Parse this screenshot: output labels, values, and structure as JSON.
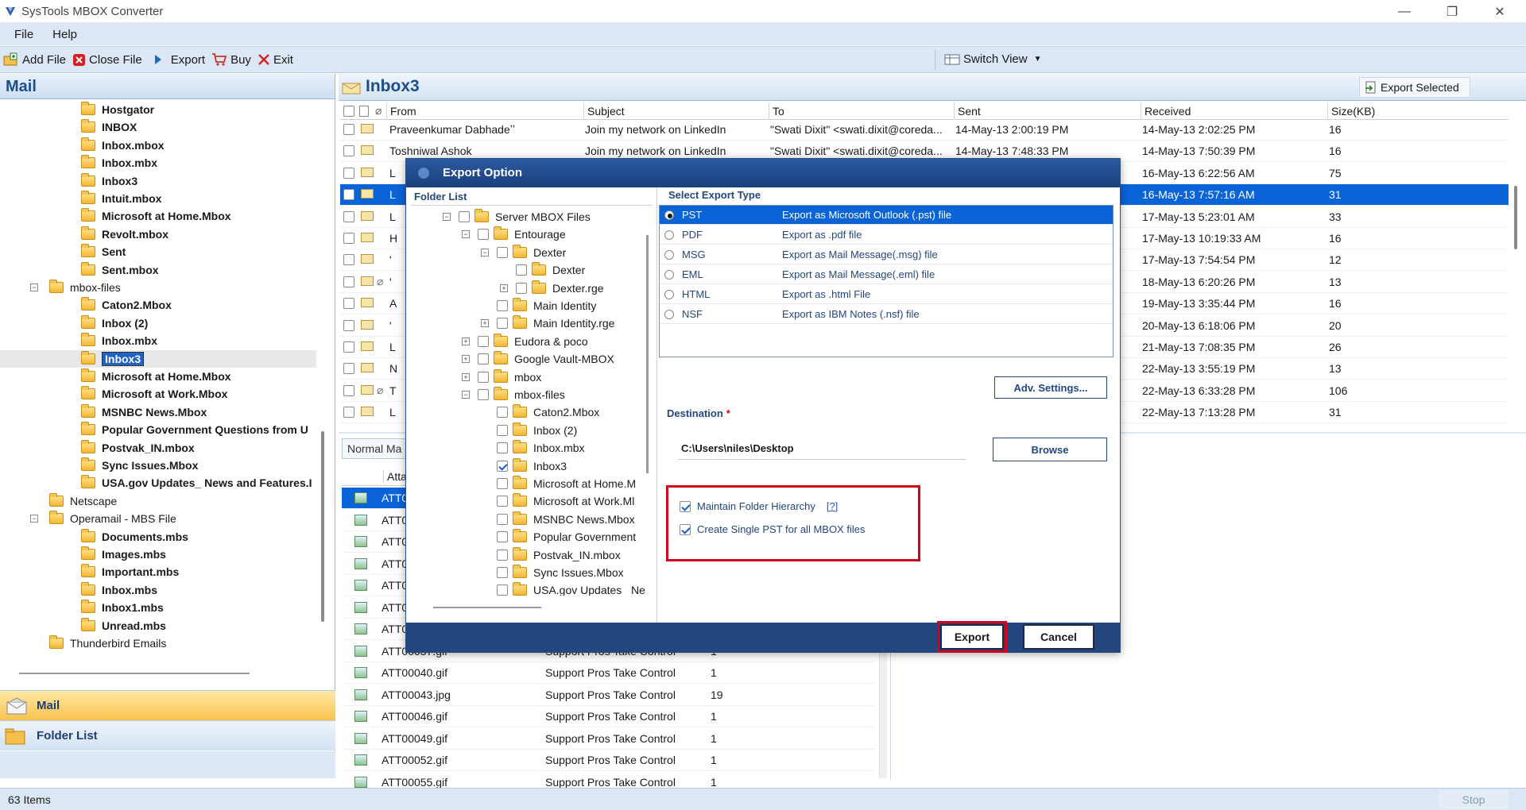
{
  "window": {
    "title": "SysTools MBOX Converter",
    "minimize": "—",
    "restore": "❐",
    "close": "✕"
  },
  "menu": {
    "file": "File",
    "help": "Help"
  },
  "toolbar": {
    "add_file": "Add File",
    "close_file": "Close File",
    "export": "Export",
    "buy": "Buy",
    "exit": "Exit",
    "switch_view": "Switch View",
    "export_selected": "Export Selected"
  },
  "left": {
    "header": "Mail",
    "tree": [
      "Hostgator",
      "INBOX",
      "Inbox.mbox",
      "Inbox.mbx",
      "Inbox3",
      "Intuit.mbox",
      "Microsoft at Home.Mbox",
      "Revolt.mbox",
      "Sent",
      "Sent.mbox",
      "mbox-files",
      "Caton2.Mbox",
      "Inbox (2)",
      "Inbox.mbx",
      "Inbox3",
      "Microsoft at Home.Mbox",
      "Microsoft at Work.Mbox",
      "MSNBC News.Mbox",
      "Popular Government Questions from U",
      "Postvak_IN.mbox",
      "Sync Issues.Mbox",
      "USA.gov Updates_ News and Features.I",
      "Netscape",
      "Operamail - MBS File",
      "Documents.mbs",
      "Images.mbs",
      "Important.mbs",
      "Inbox.mbs",
      "Inbox1.mbs",
      "Unread.mbs",
      "Thunderbird Emails"
    ],
    "nav_mail": "Mail",
    "nav_folder": "Folder List"
  },
  "main": {
    "folder_title": "Inbox3",
    "columns": {
      "from": "From",
      "subject": "Subject",
      "to": "To",
      "sent": "Sent",
      "received": "Received",
      "size": "Size(KB)"
    },
    "rows": [
      {
        "from": "Praveenkumar Dabhadeʼʼ",
        "subject": "Join my network on LinkedIn",
        "to": "\"Swati Dixit\" <swati.dixit@coreda...",
        "sent": "14-May-13 2:00:19 PM",
        "received": "14-May-13 2:02:25 PM",
        "size": "16"
      },
      {
        "from": "Toshniwal Ashok",
        "subject": "Join my network on LinkedIn",
        "to": "\"Swati Dixit\" <swati.dixit@coreda...",
        "sent": "14-May-13 7:48:33 PM",
        "received": "14-May-13 7:50:39 PM",
        "size": "16"
      },
      {
        "from": "L",
        "subject": "",
        "to": "",
        "sent": "",
        "received": "16-May-13 6:22:56 AM",
        "size": "75"
      },
      {
        "from": "L",
        "subject": "",
        "to": "",
        "sent": "",
        "received": "16-May-13 7:57:16 AM",
        "size": "31"
      },
      {
        "from": "L",
        "subject": "",
        "to": "",
        "sent": "",
        "received": "17-May-13 5:23:01 AM",
        "size": "33"
      },
      {
        "from": "H",
        "subject": "",
        "to": "",
        "sent": "",
        "received": "17-May-13 10:19:33 AM",
        "size": "16"
      },
      {
        "from": "'",
        "subject": "",
        "to": "",
        "sent": "",
        "received": "17-May-13 7:54:54 PM",
        "size": "12"
      },
      {
        "from": "'",
        "subject": "",
        "to": "",
        "sent": "",
        "received": "18-May-13 6:20:26 PM",
        "size": "13"
      },
      {
        "from": "A",
        "subject": "",
        "to": "",
        "sent": "",
        "received": "19-May-13 3:35:44 PM",
        "size": "16"
      },
      {
        "from": "'",
        "subject": "",
        "to": "",
        "sent": "",
        "received": "20-May-13 6:18:06 PM",
        "size": "20"
      },
      {
        "from": "L",
        "subject": "",
        "to": "",
        "sent": "",
        "received": "21-May-13 7:08:35 PM",
        "size": "26"
      },
      {
        "from": "N",
        "subject": "",
        "to": "",
        "sent": "",
        "received": "22-May-13 3:55:19 PM",
        "size": "13"
      },
      {
        "from": "T",
        "subject": "",
        "to": "",
        "sent": "",
        "received": "22-May-13 6:33:28 PM",
        "size": "106"
      },
      {
        "from": "L",
        "subject": "",
        "to": "",
        "sent": "",
        "received": "22-May-13 7:13:28 PM",
        "size": "31"
      }
    ],
    "preview_tab": "Normal Ma",
    "att_header": "Atta",
    "attachments": [
      {
        "name": "ATT0",
        "subject": "",
        "size": ""
      },
      {
        "name": "ATT0",
        "subject": "",
        "size": ""
      },
      {
        "name": "ATT0",
        "subject": "",
        "size": ""
      },
      {
        "name": "ATT0",
        "subject": "",
        "size": ""
      },
      {
        "name": "ATT0",
        "subject": "",
        "size": ""
      },
      {
        "name": "ATT0",
        "subject": "",
        "size": ""
      },
      {
        "name": "ATT0",
        "subject": "",
        "size": ""
      },
      {
        "name": "ATT00037.gif",
        "subject": "Support Pros Take Control",
        "size": "1"
      },
      {
        "name": "ATT00040.gif",
        "subject": "Support Pros Take Control",
        "size": "1"
      },
      {
        "name": "ATT00043.jpg",
        "subject": "Support Pros Take Control",
        "size": "19"
      },
      {
        "name": "ATT00046.gif",
        "subject": "Support Pros Take Control",
        "size": "1"
      },
      {
        "name": "ATT00049.gif",
        "subject": "Support Pros Take Control",
        "size": "1"
      },
      {
        "name": "ATT00052.gif",
        "subject": "Support Pros Take Control",
        "size": "1"
      },
      {
        "name": "ATT00055.gif",
        "subject": "Support Pros Take Control",
        "size": "1"
      }
    ]
  },
  "dialog": {
    "title": "Export Option",
    "folder_list_label": "Folder List",
    "select_type_label": "Select Export Type",
    "folders": [
      "Server MBOX Files",
      "Entourage",
      "Dexter",
      "Dexter",
      "Dexter.rge",
      "Main Identity",
      "Main Identity.rge",
      "Eudora & poco",
      "Google Vault-MBOX",
      "mbox",
      "mbox-files",
      "Caton2.Mbox",
      "Inbox (2)",
      "Inbox.mbx",
      "Inbox3",
      "Microsoft at Home.M",
      "Microsoft at Work.Ml",
      "MSNBC News.Mbox",
      "Popular Government",
      "Postvak_IN.mbox",
      "Sync Issues.Mbox",
      "USA.gov Updates_ Ne"
    ],
    "types": [
      {
        "code": "PST",
        "desc": "Export as Microsoft Outlook (.pst) file"
      },
      {
        "code": "PDF",
        "desc": "Export as .pdf file"
      },
      {
        "code": "MSG",
        "desc": "Export as Mail Message(.msg) file"
      },
      {
        "code": "EML",
        "desc": "Export as Mail Message(.eml) file"
      },
      {
        "code": "HTML",
        "desc": "Export as .html File"
      },
      {
        "code": "NSF",
        "desc": "Export as IBM Notes (.nsf) file"
      }
    ],
    "adv_settings": "Adv. Settings...",
    "destination_label": "Destination",
    "required": "*",
    "destination_value": "C:\\Users\\niles\\Desktop",
    "browse": "Browse",
    "maintain_hierarchy": "Maintain Folder Hierarchy",
    "help_link": "[?]",
    "single_pst": "Create Single PST for all MBOX files",
    "export": "Export",
    "cancel": "Cancel"
  },
  "status": {
    "items": "63 Items",
    "stop": "Stop"
  },
  "colors": {
    "accent": "#0a64d8",
    "highlight_box": "#d0021b",
    "dialog_bar": "#23467f"
  }
}
